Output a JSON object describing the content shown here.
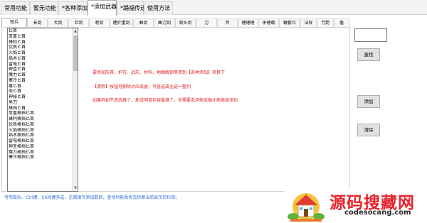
{
  "top_tabs": [
    {
      "label": "常用功能"
    },
    {
      "label": "暂无功能"
    },
    {
      "label": "*各种添加"
    },
    {
      "label": "*添加武器"
    },
    {
      "label": "*踊福传送"
    },
    {
      "label": "使用方法"
    }
  ],
  "weapon_tabs": [
    "短兵",
    "长剑",
    "大剑",
    "巨剑",
    "刺剑",
    "缠针重剑",
    "曲剑",
    "曲刀剑",
    "双头剑",
    "刀",
    "斧",
    "锤锤锤",
    "矛锤戟",
    "鞭套爪",
    "法杖",
    "弓箭",
    "盾"
  ],
  "weapon_list": [
    "匕首",
    "厚重匕首",
    "锋利匕首",
    "优质匕首",
    "火焰匕首",
    "焰术匕首",
    "雷电匕首",
    "神圣匕首",
    "魔力匕首",
    "寒冷匕首",
    "毒匕首",
    "血匕首",
    "神秘匕首",
    "黑刀",
    "格挡匕首",
    "厚重格挡匕首",
    "锋利格挡匕首",
    "优质格挡匕首",
    "火焰格挡匕首",
    "焰术格挡匕首",
    "雷电格挡匕首",
    "神圣格挡匕首",
    "魔力格挡匕首",
    "寒冷格挡匕首"
  ],
  "info_lines": [
    "要添加防具、护符、战灰、材料，地图解锁等请到【各种添加】项目下",
    "【清除】按钮可删除对应武器，可查选或全选一整列",
    "如果例如不进武器了，那说明背包容量满了，你需要丢弃些武器才能继续添加"
  ],
  "buttons": {
    "search": "查找",
    "add": "添加",
    "clear": "清除"
  },
  "search": {
    "value": ""
  },
  "hint": "可用鼠标、Ctrl键、Shift键多选，无需填写添加数目，查找功能会优先检索当前显示的栏目。",
  "watermark": {
    "title": "源码搜藏网",
    "url": "codesocang.com"
  },
  "colors": {
    "info_text": "#e52020",
    "hint_text": "#2f6bd4",
    "watermark_red": "#e8232b"
  }
}
